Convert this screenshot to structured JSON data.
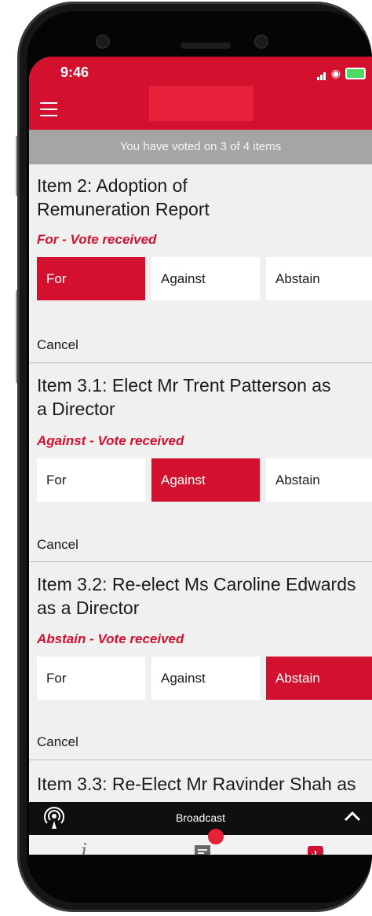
{
  "status_bar": {
    "time": "9:46"
  },
  "progress_text": "You have voted on 3 of 4 items",
  "items": [
    {
      "title_line1": "Item 2: Adoption of",
      "title_line2": "Remuneration Report",
      "status": "For - Vote received",
      "options": [
        "For",
        "Against",
        "Abstain"
      ],
      "selected": "For",
      "cancel": "Cancel"
    },
    {
      "title_line1": "Item 3.1: Elect Mr Trent Patterson as",
      "title_line2": "a Director",
      "status": "Against - Vote received",
      "options": [
        "For",
        "Against",
        "Abstain"
      ],
      "selected": "Against",
      "cancel": "Cancel"
    },
    {
      "title_line1": "Item 3.2: Re-elect Ms Caroline Edwards",
      "title_line2": "as a Director",
      "status": "Abstain - Vote received",
      "options": [
        "For",
        "Against",
        "Abstain"
      ],
      "selected": "Abstain",
      "cancel": "Cancel"
    },
    {
      "title_line1": "Item 3.3: Re-Elect Mr Ravinder Shah as"
    }
  ],
  "broadcast": {
    "label": "Broadcast",
    "icon": "broadcast-icon"
  },
  "tabs": {
    "info": "i",
    "chat_icon": "chat-icon",
    "results_icon": "results-icon"
  },
  "colors": {
    "brand_red": "#d4102f",
    "header_red": "#d4102f",
    "progress_gray": "#a5a5a5",
    "dark_bar": "#0f0f0f"
  }
}
